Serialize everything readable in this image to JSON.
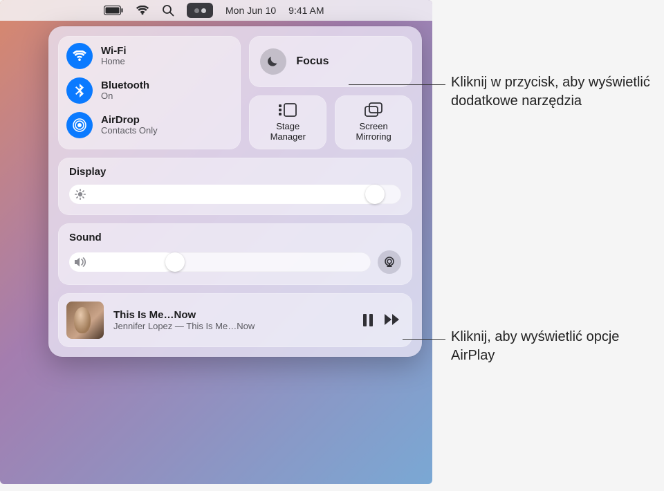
{
  "menubar": {
    "date": "Mon Jun 10",
    "time": "9:41 AM"
  },
  "connectivity": {
    "wifi": {
      "title": "Wi-Fi",
      "subtitle": "Home"
    },
    "bluetooth": {
      "title": "Bluetooth",
      "subtitle": "On"
    },
    "airdrop": {
      "title": "AirDrop",
      "subtitle": "Contacts Only"
    }
  },
  "focus": {
    "label": "Focus"
  },
  "tiles": {
    "stage_manager": {
      "line1": "Stage",
      "line2": "Manager"
    },
    "screen_mirror": {
      "line1": "Screen",
      "line2": "Mirroring"
    }
  },
  "display": {
    "title": "Display",
    "value_pct": 95
  },
  "sound": {
    "title": "Sound",
    "value_pct": 35
  },
  "now_playing": {
    "title": "This Is Me…Now",
    "subtitle": "Jennifer Lopez — This Is Me…Now"
  },
  "callouts": {
    "focus": "Kliknij w przycisk, aby wyświetlić dodatkowe narzędzia",
    "airplay": "Kliknij, aby wyświetlić opcje AirPlay"
  }
}
